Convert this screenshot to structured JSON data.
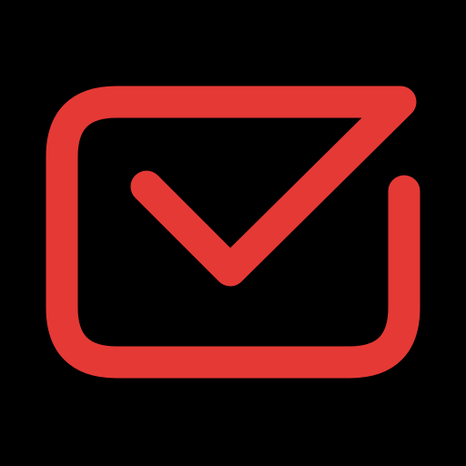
{
  "icon": {
    "name": "mail-check-icon",
    "stroke_color": "#E53935",
    "background_color": "#000000"
  }
}
